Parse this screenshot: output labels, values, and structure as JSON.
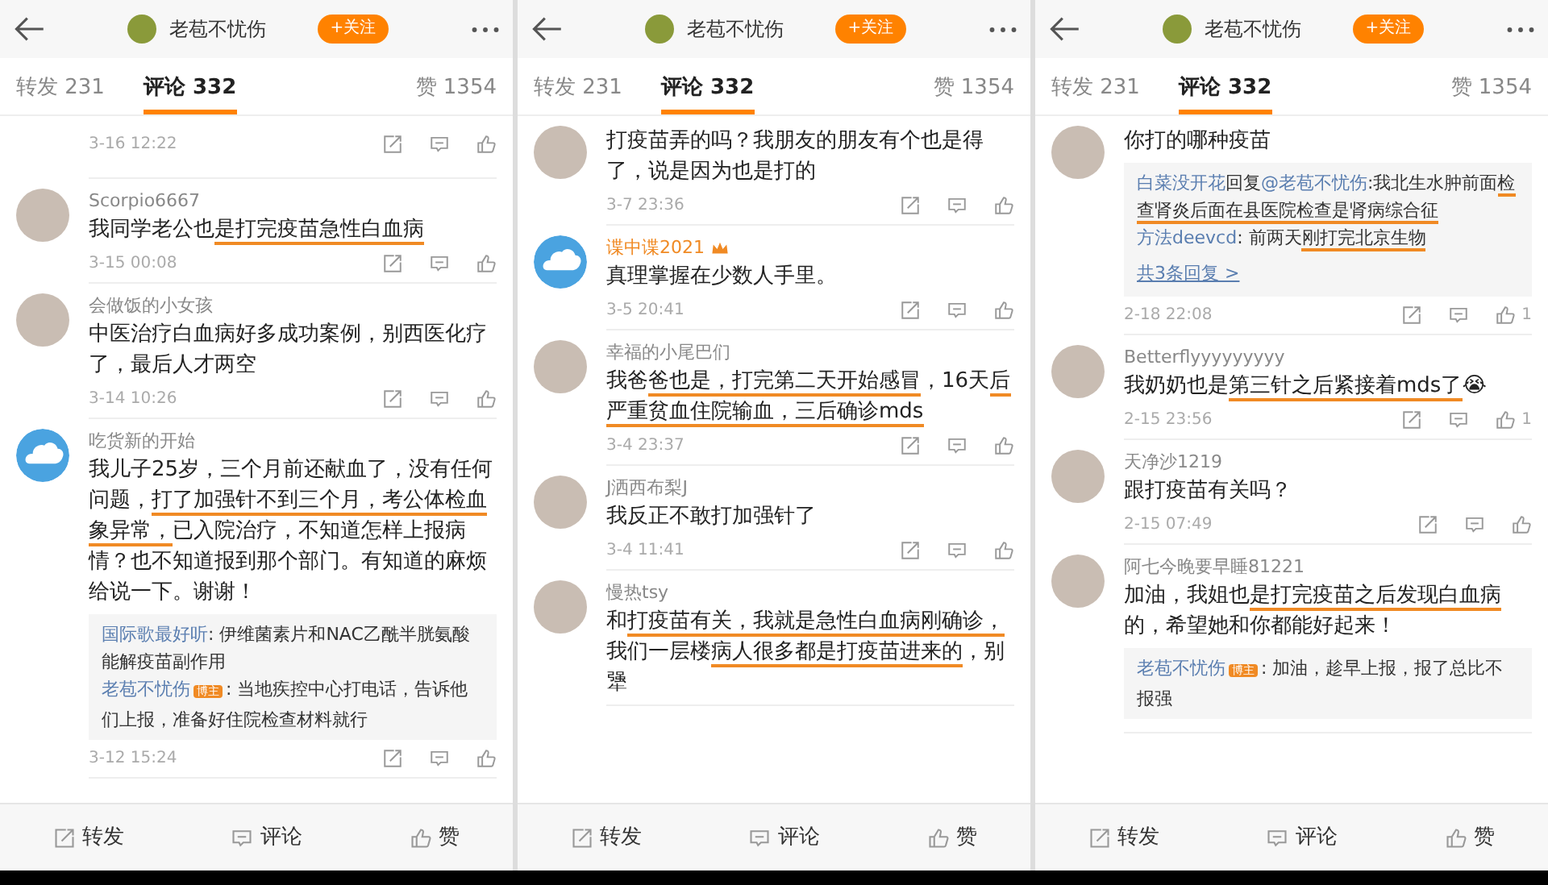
{
  "panels": [
    {
      "header": {
        "title": "老苞不忧伤",
        "follow": "+关注"
      },
      "tabs": [
        {
          "label": "转发 231",
          "selected": false
        },
        {
          "label": "评论 332",
          "selected": true
        },
        {
          "label": "赞 1354",
          "selected": false
        }
      ],
      "comments": [
        {
          "kind": "tail",
          "time": "3-16 12:22"
        },
        {
          "kind": "comment",
          "avatar": {
            "kind": "photo"
          },
          "name": "Scorpio6667",
          "body": [
            {
              "text": "我同学老公也",
              "underlined": false
            },
            {
              "text": "是打完疫苗急性白血病",
              "underlined": true
            }
          ],
          "time": "3-15 00:08"
        },
        {
          "kind": "comment",
          "avatar": {
            "kind": "photo"
          },
          "name": "会做饭的小女孩",
          "body": [
            {
              "text": "中医治疗白血病好多成功案例，别西医化疗了，最后人才两空",
              "underlined": false
            }
          ],
          "time": "3-14 10:26"
        },
        {
          "kind": "comment",
          "avatar": {
            "kind": "default"
          },
          "name": "吃货新的开始",
          "body": [
            {
              "text": "我儿子25岁，三个月前还献血了，没有任何问题，",
              "underlined": false
            },
            {
              "text": "打了加强针不到三个月，考公体检血象异常，",
              "underlined": true
            },
            {
              "text": "已入院治疗，不知道怎样上报病情？也不知道报到那个部门。有知道的麻烦给说一下。谢谢！",
              "underlined": false
            }
          ],
          "replies": [
            [
              {
                "text": "国际歌最好听",
                "kind": "link",
                "underlined": false
              },
              {
                "text": ": 伊维菌素片和NAC乙酰半胱氨酸能解疫苗副作用",
                "kind": "plain",
                "underlined": false
              }
            ],
            [
              {
                "text": "老苞不忧伤",
                "kind": "link",
                "underlined": false
              },
              {
                "text": "博主",
                "kind": "badge",
                "underlined": false
              },
              {
                "text": ": 当地疾控中心打电话，告诉他们上报，准备好住院检查材料就行",
                "kind": "plain",
                "underlined": false
              }
            ]
          ],
          "time": "3-12 15:24"
        }
      ],
      "bottom_bar": [
        "转发",
        "评论",
        "赞"
      ]
    },
    {
      "header": {
        "title": "老苞不忧伤",
        "follow": "+关注"
      },
      "tabs": [
        {
          "label": "转发 231",
          "selected": false
        },
        {
          "label": "评论 332",
          "selected": true
        },
        {
          "label": "赞 1354",
          "selected": false
        }
      ],
      "comments": [
        {
          "kind": "headless",
          "avatar": {
            "kind": "photo"
          },
          "body": [
            {
              "text": "打疫苗弄的吗？我朋友的朋友有个也是得了，说是因为也是打的",
              "underlined": false
            }
          ],
          "time": "3-7 23:36"
        },
        {
          "kind": "comment",
          "avatar": {
            "kind": "default"
          },
          "name": "谍中谍2021",
          "vip": true,
          "body": [
            {
              "text": "真理掌握在少数人手里。",
              "underlined": false
            }
          ],
          "time": "3-5 20:41"
        },
        {
          "kind": "comment",
          "avatar": {
            "kind": "photo"
          },
          "name": "幸福的小尾巴们",
          "body": [
            {
              "text": "我爸",
              "underlined": false
            },
            {
              "text": "爸也是，打完第二天开始感冒",
              "underlined": true
            },
            {
              "text": "，16天",
              "underlined": false
            },
            {
              "text": "后严重贫血住院输血，三后确诊mds",
              "underlined": true
            }
          ],
          "time": "3-4 23:37"
        },
        {
          "kind": "comment",
          "avatar": {
            "kind": "photo"
          },
          "name": "J洒西布梨J",
          "body": [
            {
              "text": "我反正不敢打加强针了",
              "underlined": false
            }
          ],
          "time": "3-4 11:41"
        },
        {
          "kind": "comment",
          "avatar": {
            "kind": "photo"
          },
          "name": "慢热tsy",
          "body": [
            {
              "text": "和",
              "underlined": false
            },
            {
              "text": "打疫苗有关，我就是急性白血病刚确诊，",
              "underlined": true
            },
            {
              "text": "我们一层楼",
              "underlined": false
            },
            {
              "text": "病人很多都是打疫苗进来的",
              "underlined": true
            },
            {
              "text": "，别犟",
              "underlined": false
            }
          ]
        }
      ],
      "bottom_bar": [
        "转发",
        "评论",
        "赞"
      ]
    },
    {
      "header": {
        "title": "老苞不忧伤",
        "follow": "+关注"
      },
      "tabs": [
        {
          "label": "转发 231",
          "selected": false
        },
        {
          "label": "评论 332",
          "selected": true
        },
        {
          "label": "赞 1354",
          "selected": false
        }
      ],
      "comments": [
        {
          "kind": "headless",
          "avatar": {
            "kind": "photo"
          },
          "body": [
            {
              "text": "你打的哪种疫苗",
              "underlined": false
            }
          ],
          "replies": [
            [
              {
                "text": "白菜没开花",
                "kind": "link",
                "underlined": false
              },
              {
                "text": "回复",
                "kind": "plain",
                "underlined": false
              },
              {
                "text": "@老苞不忧伤",
                "kind": "link",
                "underlined": false
              },
              {
                "text": ":我北生水肿前面",
                "kind": "plain",
                "underlined": false
              },
              {
                "text": "检查肾炎后面在县医院检查是肾病综合征",
                "kind": "plain",
                "underlined": true
              }
            ],
            [
              {
                "text": "方法deevcd",
                "kind": "link",
                "underlined": false
              },
              {
                "text": ": 前两天",
                "kind": "plain",
                "underlined": false
              },
              {
                "text": "刚打完北京生物",
                "kind": "plain",
                "underlined": true
              }
            ]
          ],
          "more_replies": "共3条回复 >",
          "time": "2-18 22:08",
          "likes": "1"
        },
        {
          "kind": "comment",
          "avatar": {
            "kind": "photo"
          },
          "name": "Betterflyyyyyyyyy",
          "body": [
            {
              "text": "我奶奶也是",
              "underlined": false
            },
            {
              "text": "第三针之后紧接着mds了",
              "underlined": true
            },
            {
              "text": "😭",
              "underlined": false
            }
          ],
          "time": "2-15 23:56",
          "likes": "1"
        },
        {
          "kind": "comment",
          "avatar": {
            "kind": "photo"
          },
          "name": "天净沙1219",
          "body": [
            {
              "text": "跟打疫苗有关吗？",
              "underlined": false
            }
          ],
          "time": "2-15 07:49"
        },
        {
          "kind": "comment",
          "avatar": {
            "kind": "photo"
          },
          "name": "阿七今晚要早睡81221",
          "body": [
            {
              "text": "加油，我姐也",
              "underlined": false
            },
            {
              "text": "是打完疫苗之后发现白血病",
              "underlined": true
            },
            {
              "text": "的，希望她和你都能好起来！",
              "underlined": false
            }
          ],
          "replies": [
            [
              {
                "text": "老苞不忧伤",
                "kind": "link",
                "underlined": false
              },
              {
                "text": "博主",
                "kind": "badge",
                "underlined": false
              },
              {
                "text": ": 加油，趁早上报，报了总比不报强",
                "kind": "plain",
                "underlined": false
              }
            ]
          ]
        }
      ],
      "bottom_bar": [
        "转发",
        "评论",
        "赞"
      ]
    }
  ]
}
